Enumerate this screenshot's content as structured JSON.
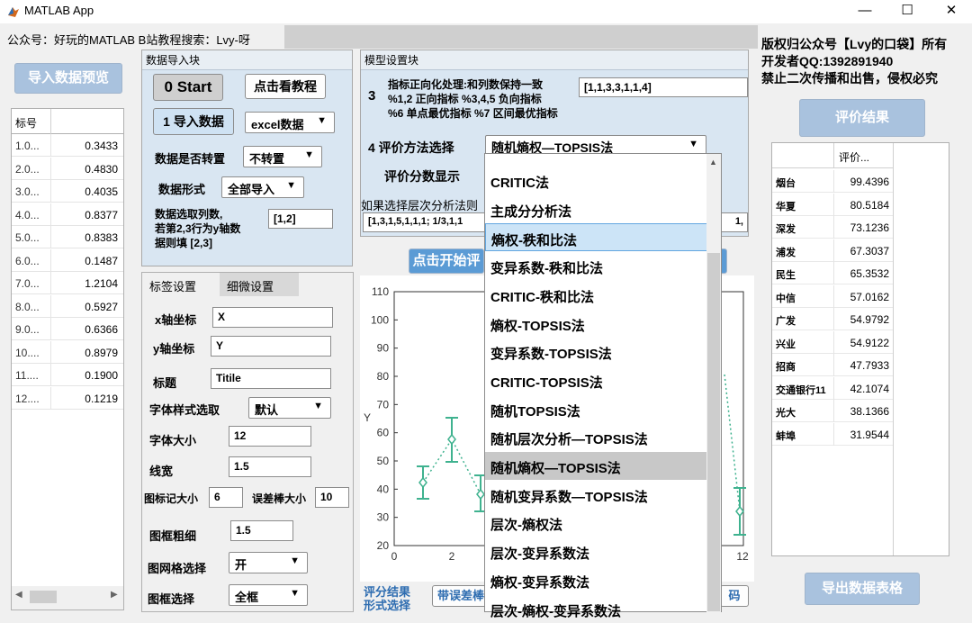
{
  "window": {
    "title": "MATLAB App",
    "minimize": "—",
    "maximize": "☐",
    "close": "✕"
  },
  "header": {
    "left_label": "公众号：好玩的MATLAB B站教程搜索：Lvy-呀"
  },
  "right_info": {
    "line1": "版权归公众号【Lvy的口袋】所有",
    "line2": "开发者QQ:1392891940",
    "line3": "禁止二次传播和出售，侵权必究"
  },
  "left": {
    "preview_button": "导入数据预览",
    "table": {
      "header": "标号",
      "rows": [
        {
          "k": "1.0...",
          "v": "0.3433"
        },
        {
          "k": "2.0...",
          "v": "0.4830"
        },
        {
          "k": "3.0...",
          "v": "0.4035"
        },
        {
          "k": "4.0...",
          "v": "0.8377"
        },
        {
          "k": "5.0...",
          "v": "0.8383"
        },
        {
          "k": "6.0...",
          "v": "0.1487"
        },
        {
          "k": "7.0...",
          "v": "1.2104"
        },
        {
          "k": "8.0...",
          "v": "0.5927"
        },
        {
          "k": "9.0...",
          "v": "0.6366"
        },
        {
          "k": "10....",
          "v": "0.8979"
        },
        {
          "k": "11....",
          "v": "0.1900"
        },
        {
          "k": "12....",
          "v": "0.1219"
        }
      ]
    }
  },
  "import_panel": {
    "title": "数据导入块",
    "start_button": "0 Start",
    "tutorial_button": "点击看教程",
    "import_button": "1 导入数据",
    "format_select": "excel数据",
    "transpose_label": "数据是否转置",
    "transpose_select": "不转置",
    "form_label": "数据形式",
    "form_select": "全部导入",
    "cols_label": "数据选取列数,\n若第2,3行为y轴数\n据则填 [2,3]",
    "cols_value": "[1,2]"
  },
  "label_panel": {
    "tabs": [
      "标签设置",
      "细微设置"
    ],
    "x_label": "x轴坐标",
    "x_value": "X",
    "y_label": "y轴坐标",
    "y_value": "Y",
    "title_label": "标题",
    "title_value": "Titile",
    "font_style_label": "字体样式选取",
    "font_style_value": "默认",
    "font_size_label": "字体大小",
    "font_size_value": "12",
    "line_width_label": "线宽",
    "line_width_value": "1.5",
    "marker_label": "图标记大小",
    "marker_value": "6",
    "errorbar_label": "误差棒大小",
    "errorbar_value": "10",
    "frame_width_label": "图框粗细",
    "frame_width_value": "1.5",
    "grid_label": "图网格选择",
    "grid_value": "开",
    "frame_label": "图框选择",
    "frame_value": "全框"
  },
  "model_panel": {
    "title": "模型设置块",
    "step3": "3",
    "pos_text": "指标正向化处理:和列数保持一致\n%1,2 正向指标  %3,4,5 负向指标\n%6 单点最优指标 %7 区间最优指标",
    "pos_value": "[1,1,3,3,1,1,4]",
    "method_label": "4 评价方法选择",
    "method_value": "随机熵权—TOPSIS法",
    "score_label": "评价分数显示",
    "ahp_hint": "如果选择层次分析法则",
    "ahp_value": "[1,3,1,5,1,1,1;    1/3,1,1",
    "ahp_value_right": "1,",
    "start_calc": "点击开始评"
  },
  "dropdown": {
    "items": [
      "CRITIC法",
      "主成分分析法",
      "熵权-秩和比法",
      "变异系数-秩和比法",
      "CRITIC-秩和比法",
      "熵权-TOPSIS法",
      "变异系数-TOPSIS法",
      "CRITIC-TOPSIS法",
      "随机TOPSIS法",
      "随机层次分析—TOPSIS法",
      "随机熵权—TOPSIS法",
      "随机变异系数—TOPSIS法",
      "层次-熵权法",
      "层次-变异系数法",
      "熵权-变异系数法",
      "层次-熵权-变异系数法"
    ],
    "highlighted": 2,
    "selected": 10
  },
  "plot": {
    "y_ticks": [
      "110",
      "100",
      "90",
      "80",
      "70",
      "60",
      "50",
      "40",
      "30",
      "20"
    ],
    "x_ticks": [
      "0",
      "2",
      "12"
    ],
    "ylabel": "Y"
  },
  "bottom": {
    "score_form": "评分结果\n形式选择",
    "errorbar_btn": "带误差棒",
    "code_btn": "码"
  },
  "results": {
    "button": "评价结果",
    "header": "评价...",
    "rows": [
      {
        "name": "烟台",
        "score": "99.4396"
      },
      {
        "name": "华夏",
        "score": "80.5184"
      },
      {
        "name": "深发",
        "score": "73.1236"
      },
      {
        "name": "浦发",
        "score": "67.3037"
      },
      {
        "name": "民生",
        "score": "65.3532"
      },
      {
        "name": "中信",
        "score": "57.0162"
      },
      {
        "name": "广发",
        "score": "54.9792"
      },
      {
        "name": "兴业",
        "score": "54.9122"
      },
      {
        "name": "招商",
        "score": "47.7933"
      },
      {
        "name": "交通银行11",
        "score": "42.1074"
      },
      {
        "name": "光大",
        "score": "38.1366"
      },
      {
        "name": "蚌埠",
        "score": "31.9544"
      }
    ],
    "export_button": "导出数据表格"
  },
  "colors": {
    "accent": "#a9c2de",
    "panel": "#d9e6f2",
    "plot_line": "#3fb28f"
  }
}
